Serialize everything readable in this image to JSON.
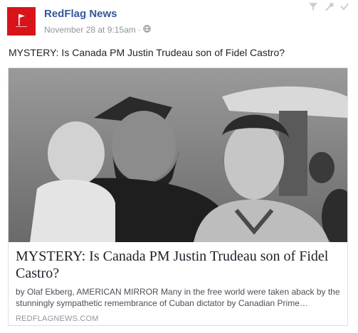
{
  "post": {
    "page_name": "RedFlag News",
    "timestamp": "November 28 at 9:15am",
    "separator": "·",
    "audience_icon": "globe-icon",
    "status_text": "MYSTERY: Is Canada PM Justin Trudeau son of Fidel Castro?"
  },
  "link_preview": {
    "title": "MYSTERY: Is Canada PM Justin Trudeau son of Fidel Castro?",
    "description": "by Olaf Ekberg, AMERICAN MIRROR Many in the free world were taken aback by the stunningly sympathetic remembrance of Cuban dictator by Canadian Prime…",
    "domain": "REDFLAGNEWS.COM",
    "image_icon": "black-and-white-photo"
  },
  "colors": {
    "brand_red": "#d8141a",
    "link_blue": "#365899",
    "meta_gray": "#90949c"
  },
  "corner_icons": [
    "filter-icon",
    "wrench-icon",
    "check-icon"
  ]
}
